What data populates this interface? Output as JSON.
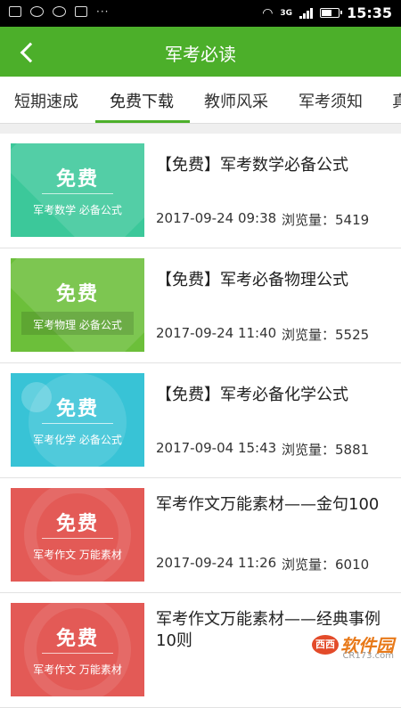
{
  "status_bar": {
    "time": "15:35",
    "network": "3G"
  },
  "header": {
    "title": "军考必读"
  },
  "tabs": [
    {
      "label": "短期速成"
    },
    {
      "label": "免费下载"
    },
    {
      "label": "教师风采"
    },
    {
      "label": "军考须知"
    },
    {
      "label": "真"
    }
  ],
  "active_tab": 1,
  "items": [
    {
      "thumb_big": "免费",
      "thumb_sub": "军考数学  必备公式",
      "thumb_color": "#3cc89a",
      "title": "【免费】军考数学必备公式",
      "date": "2017-09-24 09:38",
      "views": "浏览量：5419"
    },
    {
      "thumb_big": "免费",
      "thumb_sub": "军考物理  必备公式",
      "thumb_color": "#6cbf3a",
      "title": "【免费】军考必备物理公式",
      "date": "2017-09-24 11:40",
      "views": "浏览量：5525"
    },
    {
      "thumb_big": "免费",
      "thumb_sub": "军考化学  必备公式",
      "thumb_color": "#38c3d6",
      "title": "【免费】军考必备化学公式",
      "date": "2017-09-04 15:43",
      "views": "浏览量：5881"
    },
    {
      "thumb_big": "免费",
      "thumb_sub": "军考作文  万能素材",
      "thumb_color": "#e35a56",
      "title": "军考作文万能素材——金句100",
      "date": "2017-09-24 11:26",
      "views": "浏览量：6010"
    },
    {
      "thumb_big": "免费",
      "thumb_sub": "军考作文  万能素材",
      "thumb_color": "#e35a56",
      "title": "军考作文万能素材——经典事例10则",
      "date": "",
      "views": ""
    }
  ],
  "watermark": {
    "logo": "西西",
    "text": "软件园",
    "sub": "CR173.com"
  }
}
